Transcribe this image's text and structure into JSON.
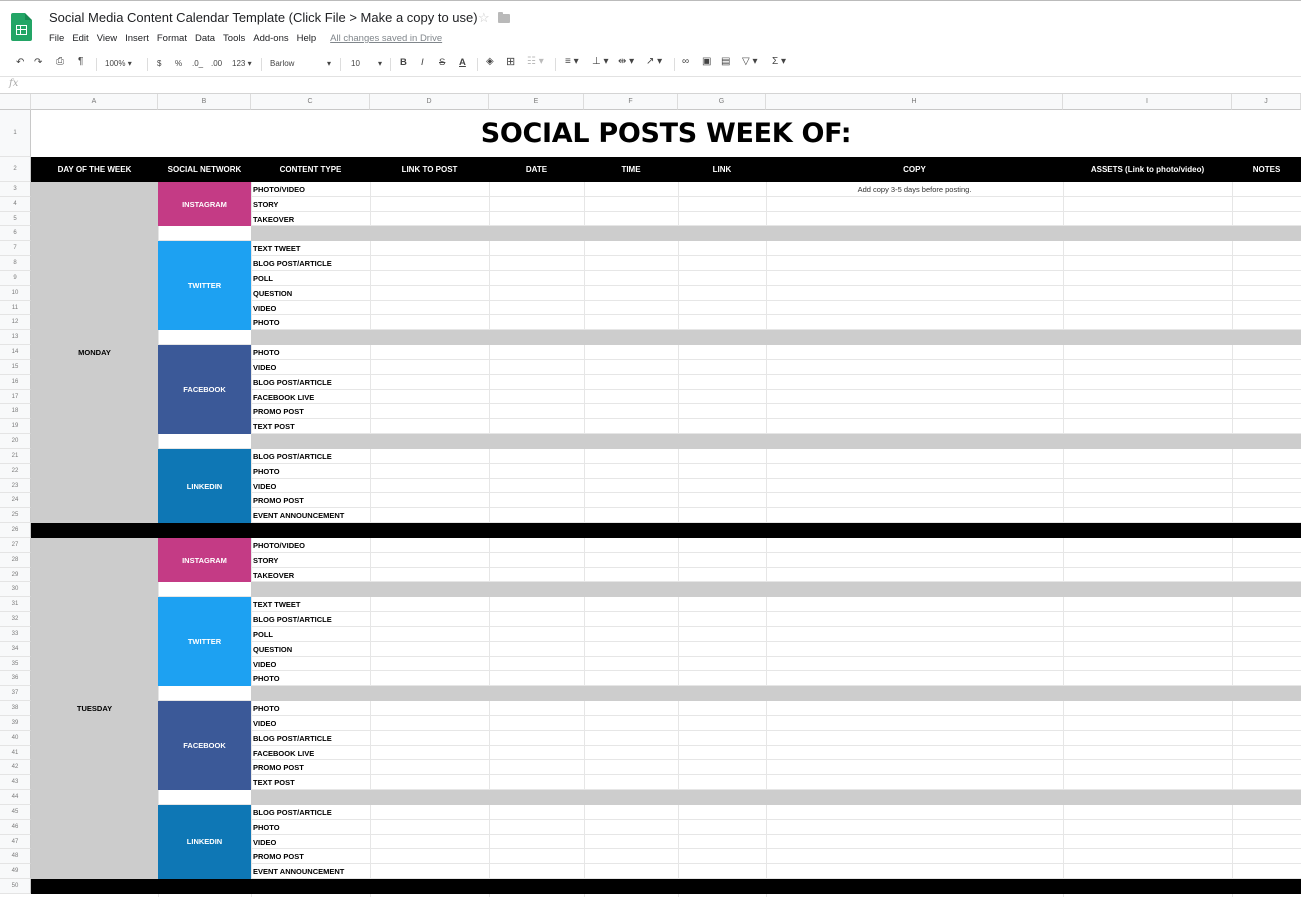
{
  "app": {
    "doc_title": "Social Media Content Calendar Template (Click File > Make a copy to use)",
    "menu": [
      "File",
      "Edit",
      "View",
      "Insert",
      "Format",
      "Data",
      "Tools",
      "Add-ons",
      "Help"
    ],
    "save_status": "All changes saved in Drive"
  },
  "toolbar": {
    "zoom": "100%",
    "currency": "$",
    "percent": "%",
    "decimal_decrease": ".0_",
    "decimal_increase": ".00",
    "number_format": "123",
    "font": "Barlow",
    "font_size": "10",
    "bold": "B",
    "italic": "I",
    "strike": "S",
    "text_color": "A"
  },
  "formula_bar": {
    "fx": "fx"
  },
  "columns": [
    "A",
    "B",
    "C",
    "D",
    "E",
    "F",
    "G",
    "H",
    "I",
    "J"
  ],
  "sheet": {
    "title": "SOCIAL POSTS WEEK OF:",
    "headers": [
      "DAY OF THE WEEK",
      "SOCIAL NETWORK",
      "CONTENT TYPE",
      "LINK TO POST",
      "DATE",
      "TIME",
      "LINK",
      "COPY",
      "ASSETS (Link to photo/video)",
      "NOTES"
    ],
    "copy_note": "Add copy 3-5 days before posting.",
    "days": [
      {
        "name": "MONDAY",
        "networks": [
          {
            "name": "INSTAGRAM",
            "color": "#c43b85",
            "items": [
              "PHOTO/VIDEO",
              "STORY",
              "TAKEOVER"
            ]
          },
          {
            "name": "TWITTER",
            "color": "#1da1f2",
            "items": [
              "TEXT TWEET",
              "BLOG POST/ARTICLE",
              "POLL",
              "QUESTION",
              "VIDEO",
              "PHOTO"
            ]
          },
          {
            "name": "FACEBOOK",
            "color": "#3b5998",
            "items": [
              "PHOTO",
              "VIDEO",
              "BLOG POST/ARTICLE",
              "FACEBOOK LIVE",
              "PROMO POST",
              "TEXT POST"
            ]
          },
          {
            "name": "LINKEDIN",
            "color": "#0e77b5",
            "items": [
              "BLOG POST/ARTICLE",
              "PHOTO",
              "VIDEO",
              "PROMO POST",
              "EVENT ANNOUNCEMENT"
            ]
          }
        ]
      },
      {
        "name": "TUESDAY",
        "networks": [
          {
            "name": "INSTAGRAM",
            "color": "#c43b85",
            "items": [
              "PHOTO/VIDEO",
              "STORY",
              "TAKEOVER"
            ]
          },
          {
            "name": "TWITTER",
            "color": "#1da1f2",
            "items": [
              "TEXT TWEET",
              "BLOG POST/ARTICLE",
              "POLL",
              "QUESTION",
              "VIDEO",
              "PHOTO"
            ]
          },
          {
            "name": "FACEBOOK",
            "color": "#3b5998",
            "items": [
              "PHOTO",
              "VIDEO",
              "BLOG POST/ARTICLE",
              "FACEBOOK LIVE",
              "PROMO POST",
              "TEXT POST"
            ]
          },
          {
            "name": "LINKEDIN",
            "color": "#0e77b5",
            "items": [
              "BLOG POST/ARTICLE",
              "PHOTO",
              "VIDEO",
              "PROMO POST",
              "EVENT ANNOUNCEMENT"
            ]
          }
        ]
      }
    ]
  }
}
